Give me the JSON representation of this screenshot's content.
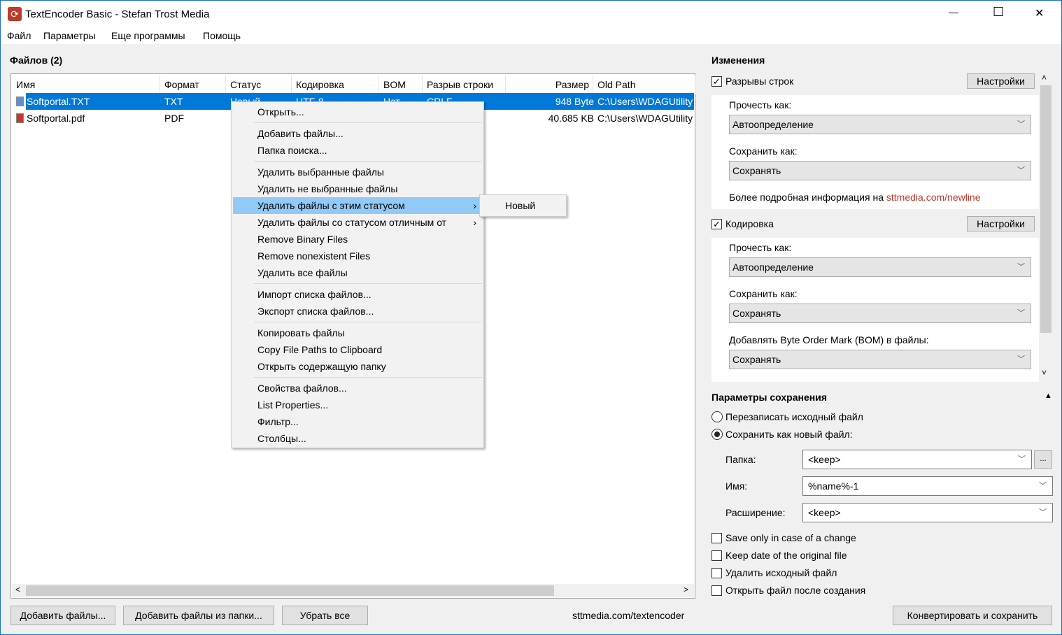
{
  "window": {
    "title": "TextEncoder Basic - Stefan Trost Media",
    "minimize": "—",
    "maximize": "☐",
    "close": "✕"
  },
  "menubar": [
    "Файл",
    "Параметры",
    "Еще программы",
    "Помощь"
  ],
  "files": {
    "title": "Файлов (2)",
    "columns": [
      "Имя",
      "Формат",
      "Статус",
      "Кодировка",
      "BOM",
      "Разрыв строки",
      "Размер",
      "Old Path"
    ],
    "rows": [
      {
        "name": "Softportal.TXT",
        "format": "TXT",
        "status": "Новый",
        "encoding": "UTF-8",
        "bom": "Нет",
        "linebreak": "CRLF",
        "size": "948 Byte",
        "oldpath": "C:\\Users\\WDAGUtility",
        "icon": "text-file-icon",
        "selected": true
      },
      {
        "name": "Softportal.pdf",
        "format": "PDF",
        "status": "",
        "encoding": "",
        "bom": "",
        "linebreak": "",
        "size": "40.685 KB",
        "oldpath": "C:\\Users\\WDAGUtility",
        "icon": "pdf-file-icon",
        "selected": false
      }
    ]
  },
  "context_menu": {
    "groups": [
      [
        "Открыть..."
      ],
      [
        "Добавить файлы...",
        "Папка поиска..."
      ],
      [
        "Удалить выбранные файлы",
        "Удалить не выбранные файлы",
        "Удалить файлы с этим статусом",
        "Удалить файлы со статусом отличным от",
        "Remove Binary Files",
        "Remove nonexistent Files",
        "Удалить все файлы"
      ],
      [
        "Импорт списка файлов...",
        "Экспорт списка файлов..."
      ],
      [
        "Копировать файлы",
        "Copy File Paths to Clipboard",
        "Открыть содержащую папку"
      ],
      [
        "Свойства файлов...",
        "List Properties...",
        "Фильтр...",
        "Столбцы..."
      ]
    ],
    "highlighted": "Удалить файлы с этим статусом",
    "has_submenu": [
      "Удалить файлы с этим статусом",
      "Удалить файлы со статусом отличным от"
    ],
    "submenu": [
      "Новый"
    ]
  },
  "bottom": {
    "add_files": "Добавить файлы...",
    "add_folder": "Добавить файлы из папки...",
    "remove_all": "Убрать все",
    "link": "sttmedia.com/textencoder",
    "convert": "Конвертировать и сохранить"
  },
  "changes": {
    "title": "Изменения",
    "linebreaks": {
      "label": "Разрывы строк",
      "checked": true,
      "settings": "Настройки",
      "read_label": "Прочесть как:",
      "read_value": "Автоопределение",
      "save_label": "Сохранить как:",
      "save_value": "Сохранять",
      "info": "Более подробная информация на",
      "info_link": "sttmedia.com/newline"
    },
    "encoding": {
      "label": "Кодировка",
      "checked": true,
      "settings": "Настройки",
      "read_label": "Прочесть как:",
      "read_value": "Автоопределение",
      "save_label": "Сохранить как:",
      "save_value": "Сохранять",
      "bom_label": "Добавлять Byte Order Mark (BOM) в файлы:",
      "bom_value": "Сохранять"
    }
  },
  "save": {
    "title": "Параметры сохранения",
    "overwrite": "Перезаписать исходный файл",
    "save_new": "Сохранить как новый файл:",
    "selected": "save_new",
    "folder_label": "Папка:",
    "folder_value": "<keep>",
    "browse": "...",
    "name_label": "Имя:",
    "name_value": "%name%-1",
    "ext_label": "Расширение:",
    "ext_value": "<keep>",
    "options": [
      {
        "label": "Save only in case of a change",
        "checked": false
      },
      {
        "label": "Keep date of the original file",
        "checked": false
      },
      {
        "label": "Удалить исходный файл",
        "checked": false
      },
      {
        "label": "Открыть файл после создания",
        "checked": false
      }
    ]
  },
  "colors": {
    "selection": "#0078d7",
    "menu_highlight": "#91c9f7",
    "link": "#c0392b"
  }
}
